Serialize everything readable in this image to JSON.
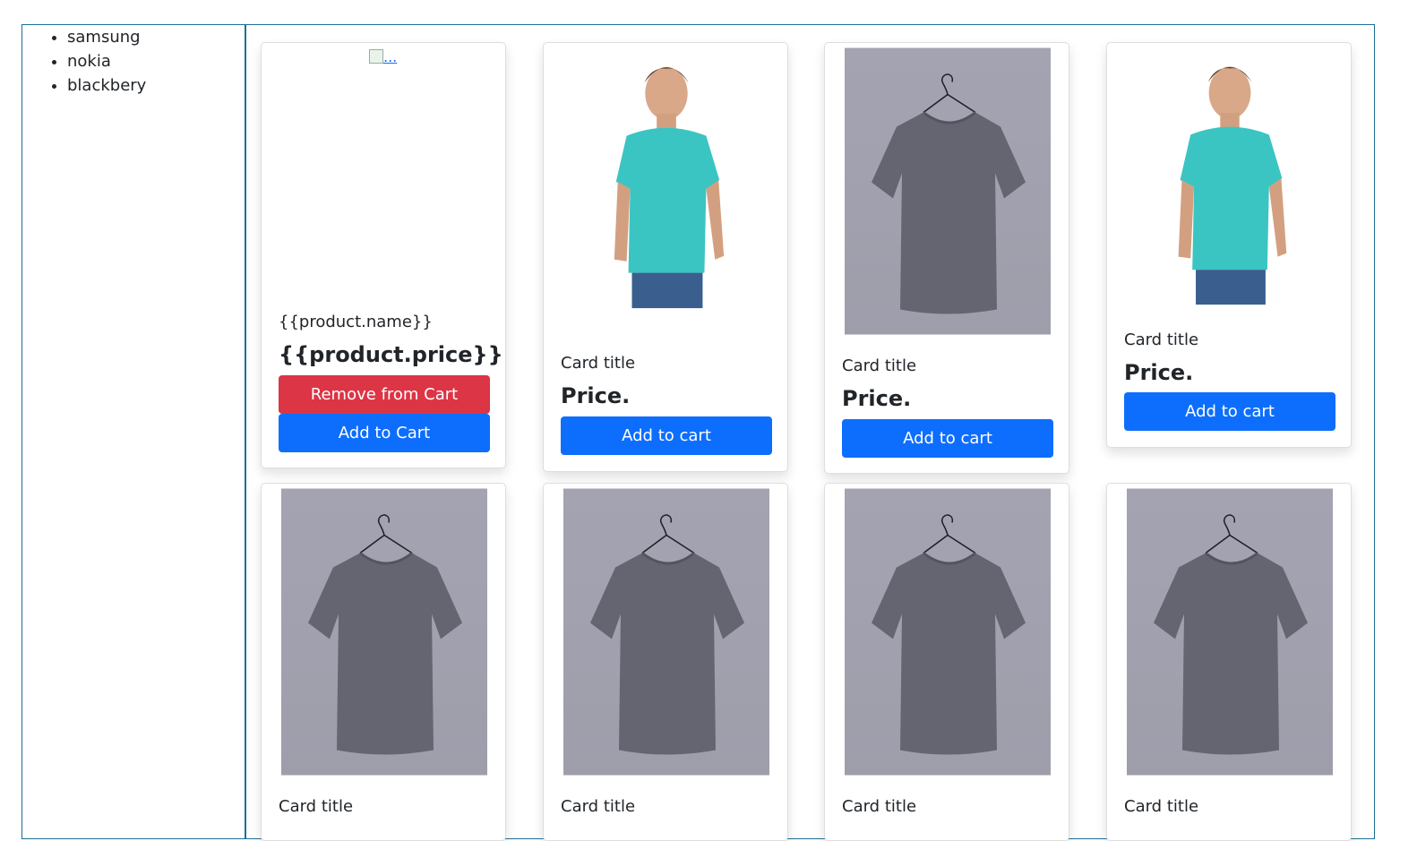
{
  "sidebar": {
    "items": [
      "samsung",
      "nokia",
      "blackbery"
    ]
  },
  "cards": [
    {
      "image": "broken-image-icon",
      "image_alt": "...",
      "title": "{{product.name}}",
      "price": "{{product.price}}",
      "remove_label": "Remove from Cart",
      "add_label": "Add to Cart"
    },
    {
      "image": "polo-shirt-man",
      "title": "Card title",
      "price": "Price.",
      "add_label": "Add to cart"
    },
    {
      "image": "gray-tshirt-hanger",
      "title": "Card title",
      "price": "Price.",
      "add_label": "Add to cart"
    },
    {
      "image": "polo-shirt-man",
      "title": "Card title",
      "price": "Price.",
      "add_label": "Add to cart"
    },
    {
      "image": "gray-tshirt-hanger",
      "title": "Card title"
    },
    {
      "image": "gray-tshirt-hanger",
      "title": "Card title"
    },
    {
      "image": "gray-tshirt-hanger",
      "title": "Card title"
    },
    {
      "image": "gray-tshirt-hanger",
      "title": "Card title"
    }
  ],
  "colors": {
    "primary": "#0d6efd",
    "danger": "#dc3545",
    "border": "#1b6f93"
  }
}
